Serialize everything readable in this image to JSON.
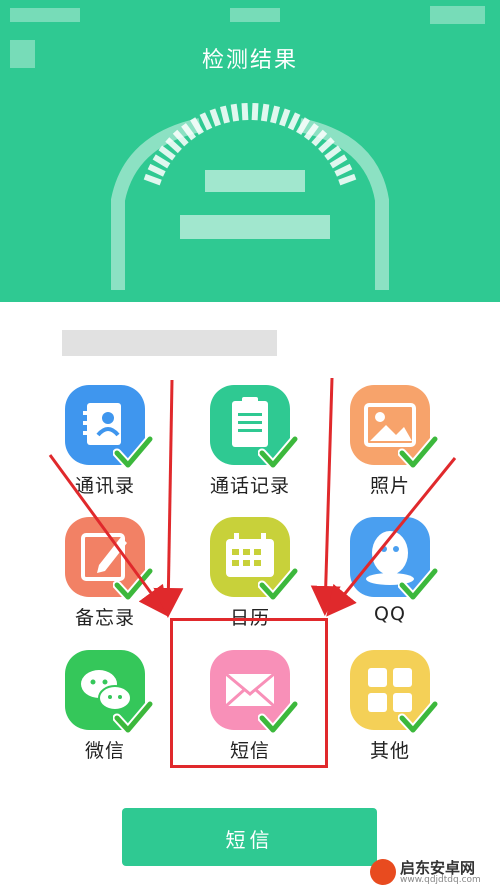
{
  "header": {
    "title": "检测结果",
    "bg_color": "#2fc992"
  },
  "grid": {
    "items": [
      {
        "label": "通讯录",
        "icon": "contacts-icon",
        "color": "#3f96ee",
        "checked": true
      },
      {
        "label": "通话记录",
        "icon": "call-log-icon",
        "color": "#2fc992",
        "checked": true
      },
      {
        "label": "照片",
        "icon": "photo-icon",
        "color": "#f7a36b",
        "checked": true
      },
      {
        "label": "备忘录",
        "icon": "memo-icon",
        "color": "#f28165",
        "checked": true
      },
      {
        "label": "日历",
        "icon": "calendar-icon",
        "color": "#c8d13a",
        "checked": true
      },
      {
        "label": "QQ",
        "icon": "qq-icon",
        "color": "#4a9ff0",
        "checked": true
      },
      {
        "label": "微信",
        "icon": "wechat-icon",
        "color": "#35c75a",
        "checked": true
      },
      {
        "label": "短信",
        "icon": "sms-icon",
        "color": "#f890b8",
        "checked": true
      },
      {
        "label": "其他",
        "icon": "other-icon",
        "color": "#f4d057",
        "checked": true
      }
    ]
  },
  "annotation": {
    "arrow_color": "#e0292c",
    "highlighted_item": "短信"
  },
  "bottom_button": {
    "label": "短信"
  },
  "watermark": {
    "text": "启东安卓网",
    "url": "www.qdjdtdq.com"
  }
}
